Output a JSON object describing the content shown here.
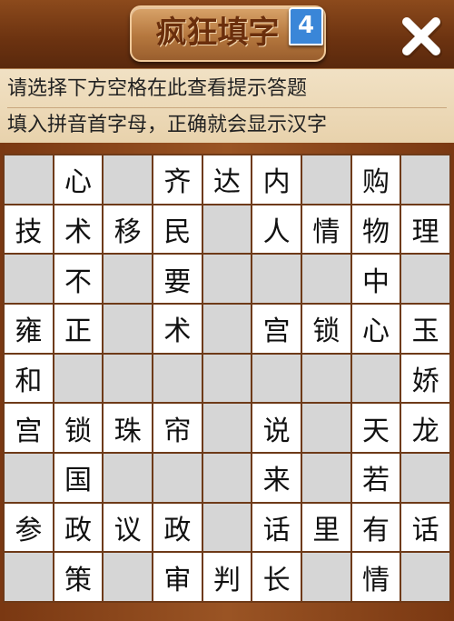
{
  "header": {
    "title": "疯狂填字",
    "level": "4"
  },
  "hints": {
    "line1": "请选择下方空格在此查看提示答题",
    "line2": "填入拼音首字母，正确就会显示汉字"
  },
  "icons": {
    "close": "close-icon"
  },
  "colors": {
    "wood": "#7a3b13",
    "badge": "#3a86d8",
    "empty_cell": "#d6d6d6",
    "filled_cell": "#ffffff"
  },
  "grid": [
    [
      "",
      "心",
      "",
      "齐",
      "达",
      "内",
      "",
      "购",
      ""
    ],
    [
      "技",
      "术",
      "移",
      "民",
      "",
      "人",
      "情",
      "物",
      "理"
    ],
    [
      "",
      "不",
      "",
      "要",
      "",
      "",
      "",
      "中",
      ""
    ],
    [
      "雍",
      "正",
      "",
      "术",
      "",
      "宫",
      "锁",
      "心",
      "玉"
    ],
    [
      "和",
      "",
      "",
      "",
      "",
      "",
      "",
      "",
      "娇"
    ],
    [
      "宫",
      "锁",
      "珠",
      "帘",
      "",
      "说",
      "",
      "天",
      "龙"
    ],
    [
      "",
      "国",
      "",
      "",
      "",
      "来",
      "",
      "若",
      ""
    ],
    [
      "参",
      "政",
      "议",
      "政",
      "",
      "话",
      "里",
      "有",
      "话"
    ],
    [
      "",
      "策",
      "",
      "审",
      "判",
      "长",
      "",
      "情",
      ""
    ]
  ]
}
